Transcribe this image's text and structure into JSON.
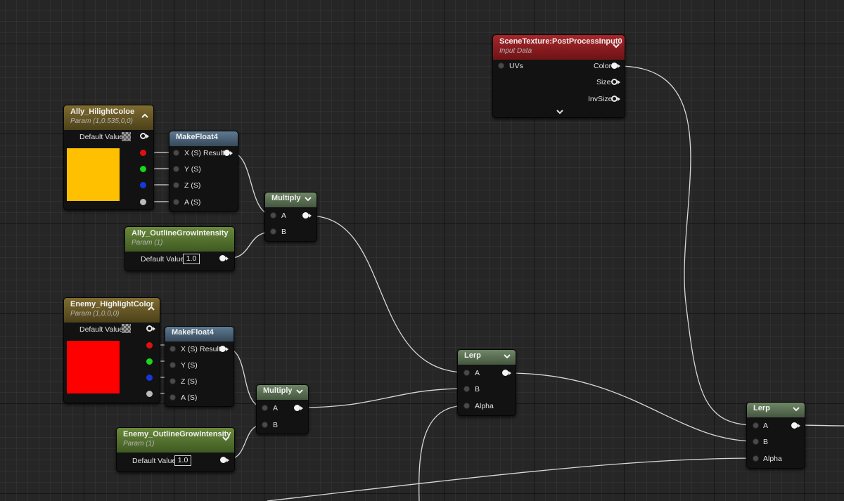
{
  "nodes": {
    "scene_texture": {
      "title": "SceneTexture:PostProcessInput0",
      "subtitle": "Input Data",
      "inputs": [
        "UVs"
      ],
      "outputs": [
        "Color",
        "Size",
        "InvSize"
      ]
    },
    "ally_color": {
      "title": "Ally_HilightColoe",
      "subtitle": "Param (1,0.535,0,0)",
      "default_label": "Default Value",
      "swatch_color": "#FFC000"
    },
    "makefloat_1": {
      "title": "MakeFloat4",
      "inputs": [
        "X (S)",
        "Y (S)",
        "Z (S)",
        "A (S)"
      ],
      "output": "Result"
    },
    "multiply_1": {
      "title": "Multiply",
      "inputs": [
        "A",
        "B"
      ]
    },
    "ally_intensity": {
      "title": "Ally_OutlineGrowIntensity",
      "subtitle": "Param (1)",
      "default_label": "Default Value",
      "value": "1.0"
    },
    "enemy_color": {
      "title": "Enemy_HighlightColor",
      "subtitle": "Param (1,0,0,0)",
      "default_label": "Default Value",
      "swatch_color": "#FF0000"
    },
    "makefloat_2": {
      "title": "MakeFloat4",
      "inputs": [
        "X (S)",
        "Y (S)",
        "Z (S)",
        "A (S)"
      ],
      "output": "Result"
    },
    "multiply_2": {
      "title": "Multiply",
      "inputs": [
        "A",
        "B"
      ]
    },
    "enemy_intensity": {
      "title": "Enemy_OutlineGrowIntensity",
      "subtitle": "Param (1)",
      "default_label": "Default Value",
      "value": "1.0"
    },
    "lerp_1": {
      "title": "Lerp",
      "inputs": [
        "A",
        "B",
        "Alpha"
      ]
    },
    "lerp_2": {
      "title": "Lerp",
      "inputs": [
        "A",
        "B",
        "Alpha"
      ]
    }
  },
  "colors": {
    "background": "#262626",
    "node_body": "#121212",
    "wire": "#d8d8d8",
    "header_param": "#7f6c30",
    "header_scalar": "#6a8a3c",
    "header_function": "#5e7a92",
    "header_math": "#6f8766",
    "header_texture": "#a8262a"
  },
  "icons": [
    "chevron-down-icon",
    "chevron-up-icon",
    "expand-arrow-icon",
    "checker-preview-icon"
  ]
}
